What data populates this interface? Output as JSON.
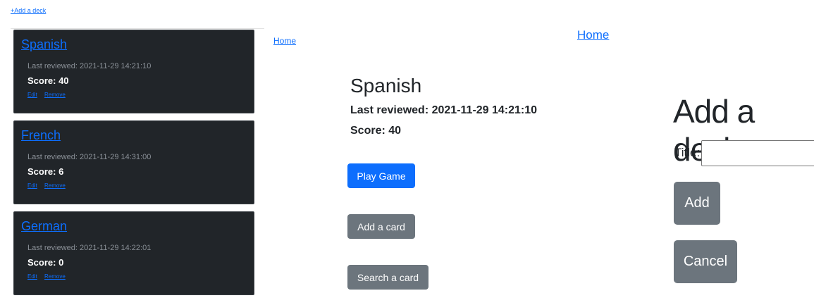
{
  "header": {
    "add_deck_link": "+Add a deck"
  },
  "decks": [
    {
      "title": "Spanish",
      "last_reviewed": "Last reviewed: 2021-11-29 14:21:10",
      "score": "Score: 40",
      "edit": "Edit",
      "remove": "Remove"
    },
    {
      "title": "French",
      "last_reviewed": "Last reviewed: 2021-11-29 14:31:00",
      "score": "Score: 6",
      "edit": "Edit",
      "remove": "Remove"
    },
    {
      "title": "German",
      "last_reviewed": "Last reviewed: 2021-11-29 14:22:01",
      "score": "Score: 0",
      "edit": "Edit",
      "remove": "Remove"
    }
  ],
  "nav": {
    "home_small": "Home",
    "home_large": "Home"
  },
  "detail": {
    "title": "Spanish",
    "last_reviewed": "Last reviewed: 2021-11-29 14:21:10",
    "score": "Score: 40",
    "play_button": "Play Game",
    "add_card_button": "Add a card",
    "search_card_button": "Search a card"
  },
  "form": {
    "heading": "Add a deck",
    "title_label": "Title:",
    "title_value": "",
    "add_button": "Add",
    "cancel_button": "Cancel"
  },
  "colors": {
    "primary": "#0d6efd",
    "secondary": "#6c757d",
    "card_bg": "#212529"
  }
}
